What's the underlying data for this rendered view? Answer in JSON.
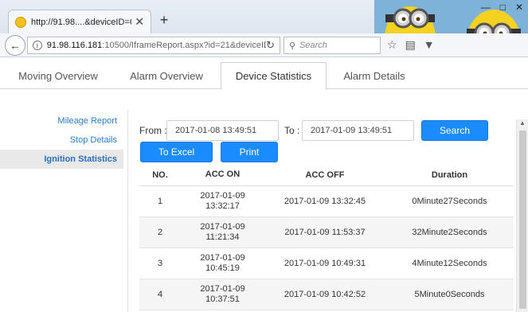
{
  "browser": {
    "tab_title": "http://91.98....&deviceID=67",
    "tab_close": "✕",
    "new_tab": "+",
    "window_controls": [
      "—",
      "□",
      "✕"
    ],
    "url_host": "91.98.116.181",
    "url_path": ":10500/IframeReport.aspx?id=21&deviceID",
    "search_placeholder": "Search",
    "icons": [
      "back-icon",
      "info-icon",
      "reload-icon",
      "search-icon",
      "star-icon",
      "reader-icon",
      "pocket-icon",
      "home-icon",
      "menu-icon"
    ]
  },
  "page_tabs": [
    {
      "label": "Moving Overview",
      "active": false
    },
    {
      "label": "Alarm Overview",
      "active": false
    },
    {
      "label": "Device Statistics",
      "active": true
    },
    {
      "label": "Alarm Details",
      "active": false
    }
  ],
  "sidemenu": [
    {
      "label": "Mileage Report",
      "active": false
    },
    {
      "label": "Stop Details",
      "active": false
    },
    {
      "label": "Ignition Statistics",
      "active": true
    }
  ],
  "filters": {
    "from_label": "From :",
    "from_value": "2017-01-08 13:49:51",
    "to_label": "To :",
    "to_value": "2017-01-09 13:49:51",
    "search_button": "Search",
    "excel_button": "To Excel",
    "print_button": "Print"
  },
  "table": {
    "headers": [
      "NO.",
      "ACC ON",
      "ACC OFF",
      "Duration"
    ],
    "rows": [
      {
        "no": "1",
        "acc_on_date": "2017-01-09",
        "acc_on_time": "13:32:17",
        "acc_off": "2017-01-09 13:32:45",
        "duration": "0Minute27Seconds"
      },
      {
        "no": "2",
        "acc_on_date": "2017-01-09",
        "acc_on_time": "11:21:34",
        "acc_off": "2017-01-09 11:53:37",
        "duration": "32Minute2Seconds"
      },
      {
        "no": "3",
        "acc_on_date": "2017-01-09",
        "acc_on_time": "10:45:19",
        "acc_off": "2017-01-09 10:49:31",
        "duration": "4Minute12Seconds"
      },
      {
        "no": "4",
        "acc_on_date": "2017-01-09",
        "acc_on_time": "10:37:51",
        "acc_off": "2017-01-09 10:42:52",
        "duration": "5Minute0Seconds"
      }
    ]
  },
  "colors": {
    "accent": "#1a8cff",
    "link": "#2a7cc7"
  }
}
